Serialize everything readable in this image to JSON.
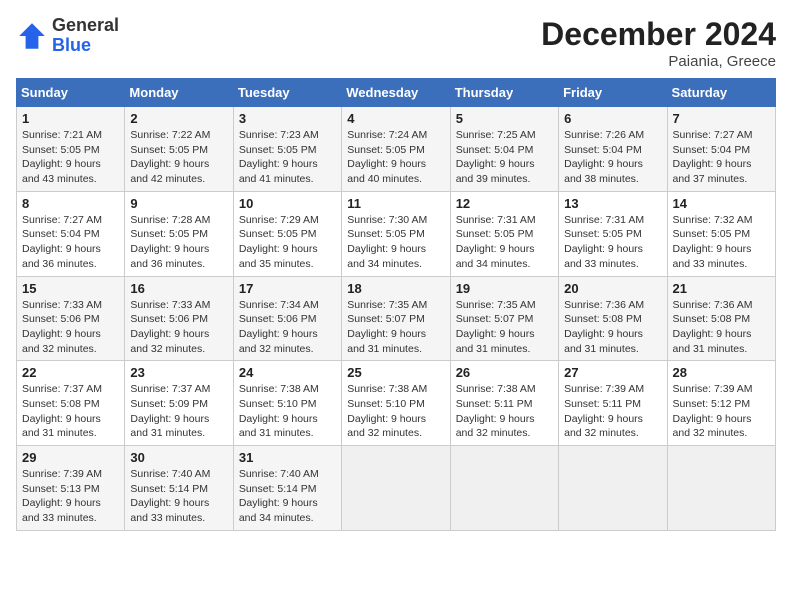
{
  "logo": {
    "general": "General",
    "blue": "Blue"
  },
  "header": {
    "month": "December 2024",
    "location": "Paiania, Greece"
  },
  "weekdays": [
    "Sunday",
    "Monday",
    "Tuesday",
    "Wednesday",
    "Thursday",
    "Friday",
    "Saturday"
  ],
  "weeks": [
    [
      {
        "day": 1,
        "sunrise": "7:21 AM",
        "sunset": "5:05 PM",
        "daylight": "9 hours and 43 minutes."
      },
      {
        "day": 2,
        "sunrise": "7:22 AM",
        "sunset": "5:05 PM",
        "daylight": "9 hours and 42 minutes."
      },
      {
        "day": 3,
        "sunrise": "7:23 AM",
        "sunset": "5:05 PM",
        "daylight": "9 hours and 41 minutes."
      },
      {
        "day": 4,
        "sunrise": "7:24 AM",
        "sunset": "5:05 PM",
        "daylight": "9 hours and 40 minutes."
      },
      {
        "day": 5,
        "sunrise": "7:25 AM",
        "sunset": "5:04 PM",
        "daylight": "9 hours and 39 minutes."
      },
      {
        "day": 6,
        "sunrise": "7:26 AM",
        "sunset": "5:04 PM",
        "daylight": "9 hours and 38 minutes."
      },
      {
        "day": 7,
        "sunrise": "7:27 AM",
        "sunset": "5:04 PM",
        "daylight": "9 hours and 37 minutes."
      }
    ],
    [
      {
        "day": 8,
        "sunrise": "7:27 AM",
        "sunset": "5:04 PM",
        "daylight": "9 hours and 36 minutes."
      },
      {
        "day": 9,
        "sunrise": "7:28 AM",
        "sunset": "5:05 PM",
        "daylight": "9 hours and 36 minutes."
      },
      {
        "day": 10,
        "sunrise": "7:29 AM",
        "sunset": "5:05 PM",
        "daylight": "9 hours and 35 minutes."
      },
      {
        "day": 11,
        "sunrise": "7:30 AM",
        "sunset": "5:05 PM",
        "daylight": "9 hours and 34 minutes."
      },
      {
        "day": 12,
        "sunrise": "7:31 AM",
        "sunset": "5:05 PM",
        "daylight": "9 hours and 34 minutes."
      },
      {
        "day": 13,
        "sunrise": "7:31 AM",
        "sunset": "5:05 PM",
        "daylight": "9 hours and 33 minutes."
      },
      {
        "day": 14,
        "sunrise": "7:32 AM",
        "sunset": "5:05 PM",
        "daylight": "9 hours and 33 minutes."
      }
    ],
    [
      {
        "day": 15,
        "sunrise": "7:33 AM",
        "sunset": "5:06 PM",
        "daylight": "9 hours and 32 minutes."
      },
      {
        "day": 16,
        "sunrise": "7:33 AM",
        "sunset": "5:06 PM",
        "daylight": "9 hours and 32 minutes."
      },
      {
        "day": 17,
        "sunrise": "7:34 AM",
        "sunset": "5:06 PM",
        "daylight": "9 hours and 32 minutes."
      },
      {
        "day": 18,
        "sunrise": "7:35 AM",
        "sunset": "5:07 PM",
        "daylight": "9 hours and 31 minutes."
      },
      {
        "day": 19,
        "sunrise": "7:35 AM",
        "sunset": "5:07 PM",
        "daylight": "9 hours and 31 minutes."
      },
      {
        "day": 20,
        "sunrise": "7:36 AM",
        "sunset": "5:08 PM",
        "daylight": "9 hours and 31 minutes."
      },
      {
        "day": 21,
        "sunrise": "7:36 AM",
        "sunset": "5:08 PM",
        "daylight": "9 hours and 31 minutes."
      }
    ],
    [
      {
        "day": 22,
        "sunrise": "7:37 AM",
        "sunset": "5:08 PM",
        "daylight": "9 hours and 31 minutes."
      },
      {
        "day": 23,
        "sunrise": "7:37 AM",
        "sunset": "5:09 PM",
        "daylight": "9 hours and 31 minutes."
      },
      {
        "day": 24,
        "sunrise": "7:38 AM",
        "sunset": "5:10 PM",
        "daylight": "9 hours and 31 minutes."
      },
      {
        "day": 25,
        "sunrise": "7:38 AM",
        "sunset": "5:10 PM",
        "daylight": "9 hours and 32 minutes."
      },
      {
        "day": 26,
        "sunrise": "7:38 AM",
        "sunset": "5:11 PM",
        "daylight": "9 hours and 32 minutes."
      },
      {
        "day": 27,
        "sunrise": "7:39 AM",
        "sunset": "5:11 PM",
        "daylight": "9 hours and 32 minutes."
      },
      {
        "day": 28,
        "sunrise": "7:39 AM",
        "sunset": "5:12 PM",
        "daylight": "9 hours and 32 minutes."
      }
    ],
    [
      {
        "day": 29,
        "sunrise": "7:39 AM",
        "sunset": "5:13 PM",
        "daylight": "9 hours and 33 minutes."
      },
      {
        "day": 30,
        "sunrise": "7:40 AM",
        "sunset": "5:14 PM",
        "daylight": "9 hours and 33 minutes."
      },
      {
        "day": 31,
        "sunrise": "7:40 AM",
        "sunset": "5:14 PM",
        "daylight": "9 hours and 34 minutes."
      },
      null,
      null,
      null,
      null
    ]
  ],
  "labels": {
    "sunrise": "Sunrise:",
    "sunset": "Sunset:",
    "daylight": "Daylight:"
  }
}
